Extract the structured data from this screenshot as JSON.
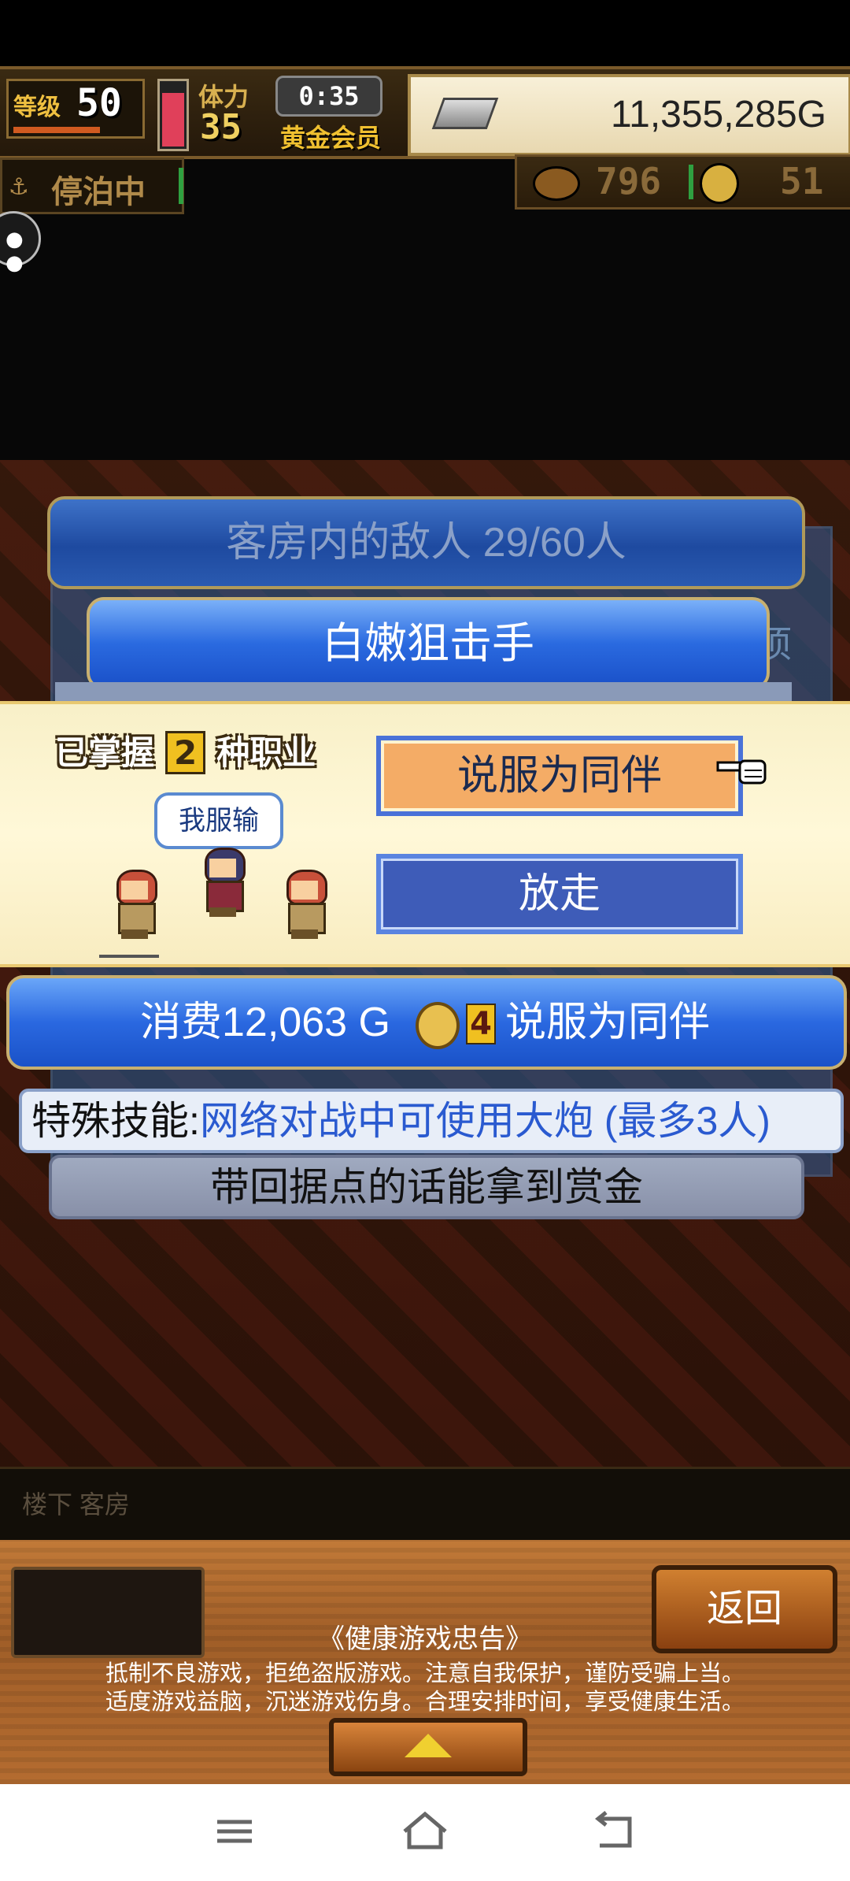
{
  "hud": {
    "level_label": "等级",
    "level_value": "50",
    "stamina_label": "体力",
    "stamina_value": "35",
    "timer": "0:35",
    "member": "黄金会员",
    "gold": "11,355,285G",
    "docked_status": "停泊中",
    "food_count": "796",
    "coin_count": "51"
  },
  "dialog": {
    "header": "客房内的敌人  29/60人",
    "enemy_name": "白嫩狙击手",
    "behind_text": "项",
    "jobs_prefix": "已掌握",
    "jobs_num": "2",
    "jobs_suffix": "种职业",
    "speech": "我服输",
    "persuade_label": "说服为同伴",
    "release_label": "放走",
    "cost_text": "消费12,063 G",
    "cost_coin_num": "4",
    "cost_action": "说服为同伴",
    "skill_label": "特殊技能:",
    "skill_value": "网络对战中可使用大炮 (最多3人)",
    "bounty_text": "带回据点的话能拿到赏金"
  },
  "bottom": {
    "location": "楼下 客房",
    "back_label": "返回",
    "notice_title": "《健康游戏忠告》",
    "notice_line1": "抵制不良游戏，拒绝盗版游戏。注意自我保护，谨防受骗上当。",
    "notice_line2": "适度游戏益脑，沉迷游戏伤身。合理安排时间，享受健康生活。"
  },
  "stamina_level": 0.85,
  "icons": [
    "anchor-icon",
    "silver-bar-icon",
    "food-icon",
    "coin-icon",
    "chat-icon",
    "pointing-hand-icon",
    "expand-up-icon",
    "menu-icon",
    "home-icon",
    "back-icon"
  ],
  "colors": {
    "accent_blue": "#2a68e0",
    "persuade_orange": "#f4ac66",
    "panel_cream": "#fff8d8"
  }
}
